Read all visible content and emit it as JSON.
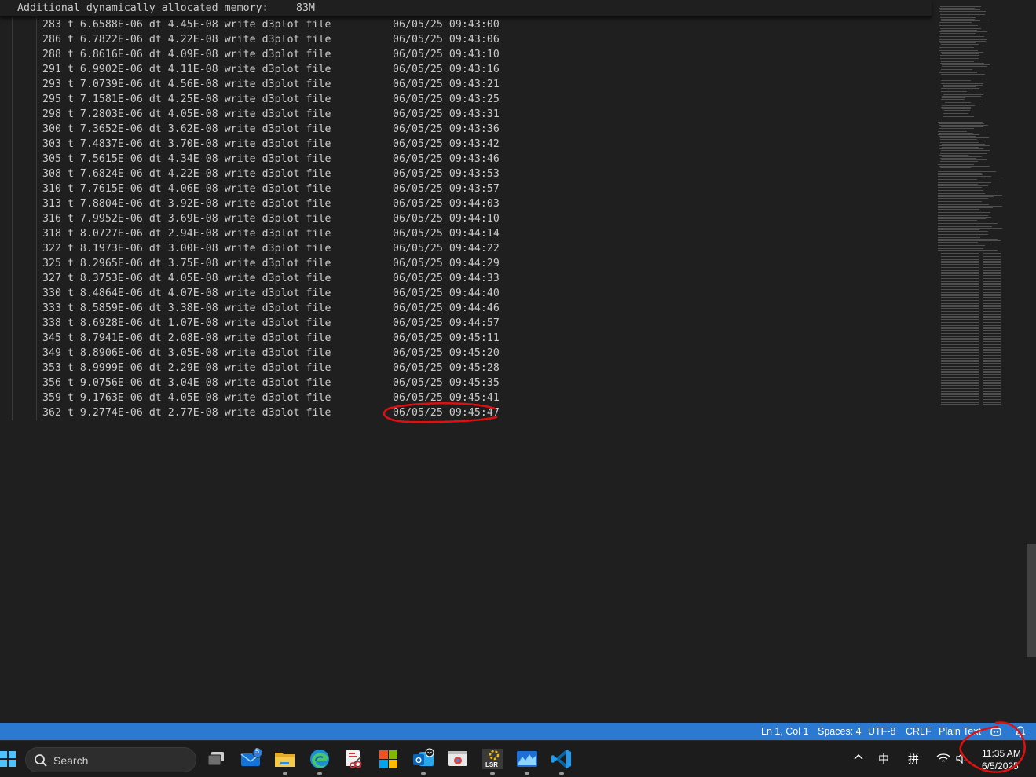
{
  "editor": {
    "sticky_line": {
      "label": "Additional dynamically allocated memory:",
      "value": "83M"
    },
    "lines": [
      {
        "text": "283 t 6.6588E-06 dt 4.45E-08 write d3plot file",
        "time": "06/05/25 09:43:00"
      },
      {
        "text": "286 t 6.7822E-06 dt 4.22E-08 write d3plot file",
        "time": "06/05/25 09:43:06"
      },
      {
        "text": "288 t 6.8616E-06 dt 4.09E-08 write d3plot file",
        "time": "06/05/25 09:43:10"
      },
      {
        "text": "291 t 6.9902E-06 dt 4.11E-08 write d3plot file",
        "time": "06/05/25 09:43:16"
      },
      {
        "text": "293 t 7.0739E-06 dt 4.56E-08 write d3plot file",
        "time": "06/05/25 09:43:21"
      },
      {
        "text": "295 t 7.1581E-06 dt 4.25E-08 write d3plot file",
        "time": "06/05/25 09:43:25"
      },
      {
        "text": "298 t 7.2803E-06 dt 4.05E-08 write d3plot file",
        "time": "06/05/25 09:43:31"
      },
      {
        "text": "300 t 7.3652E-06 dt 3.62E-08 write d3plot file",
        "time": "06/05/25 09:43:36"
      },
      {
        "text": "303 t 7.4837E-06 dt 3.70E-08 write d3plot file",
        "time": "06/05/25 09:43:42"
      },
      {
        "text": "305 t 7.5615E-06 dt 4.34E-08 write d3plot file",
        "time": "06/05/25 09:43:46"
      },
      {
        "text": "308 t 7.6824E-06 dt 4.22E-08 write d3plot file",
        "time": "06/05/25 09:43:53"
      },
      {
        "text": "310 t 7.7615E-06 dt 4.06E-08 write d3plot file",
        "time": "06/05/25 09:43:57"
      },
      {
        "text": "313 t 7.8804E-06 dt 3.92E-08 write d3plot file",
        "time": "06/05/25 09:44:03"
      },
      {
        "text": "316 t 7.9952E-06 dt 3.69E-08 write d3plot file",
        "time": "06/05/25 09:44:10"
      },
      {
        "text": "318 t 8.0727E-06 dt 2.94E-08 write d3plot file",
        "time": "06/05/25 09:44:14"
      },
      {
        "text": "322 t 8.1973E-06 dt 3.00E-08 write d3plot file",
        "time": "06/05/25 09:44:22"
      },
      {
        "text": "325 t 8.2965E-06 dt 3.75E-08 write d3plot file",
        "time": "06/05/25 09:44:29"
      },
      {
        "text": "327 t 8.3753E-06 dt 4.05E-08 write d3plot file",
        "time": "06/05/25 09:44:33"
      },
      {
        "text": "330 t 8.4864E-06 dt 4.07E-08 write d3plot file",
        "time": "06/05/25 09:44:40"
      },
      {
        "text": "333 t 8.5859E-06 dt 3.38E-08 write d3plot file",
        "time": "06/05/25 09:44:46"
      },
      {
        "text": "338 t 8.6928E-06 dt 1.07E-08 write d3plot file",
        "time": "06/05/25 09:44:57"
      },
      {
        "text": "345 t 8.7941E-06 dt 2.08E-08 write d3plot file",
        "time": "06/05/25 09:45:11"
      },
      {
        "text": "349 t 8.8906E-06 dt 3.05E-08 write d3plot file",
        "time": "06/05/25 09:45:20"
      },
      {
        "text": "353 t 8.9999E-06 dt 2.29E-08 write d3plot file",
        "time": "06/05/25 09:45:28"
      },
      {
        "text": "356 t 9.0756E-06 dt 3.04E-08 write d3plot file",
        "time": "06/05/25 09:45:35"
      },
      {
        "text": "359 t 9.1763E-06 dt 4.05E-08 write d3plot file",
        "time": "06/05/25 09:45:41"
      },
      {
        "text": "362 t 9.2774E-06 dt 2.77E-08 write d3plot file",
        "time": "06/05/25 09:45:47"
      }
    ]
  },
  "statusbar": {
    "position": "Ln 1, Col 1",
    "spaces": "Spaces: 4",
    "encoding": "UTF-8",
    "eol": "CRLF",
    "language": "Plain Text",
    "copilot_icon": "copilot-icon",
    "bell_icon": "bell-icon",
    "color": "#2b79d1"
  },
  "taskbar": {
    "search_placeholder": "Search",
    "mail_badge": "5",
    "apps": [
      "task-view",
      "mail",
      "file-explorer",
      "edge",
      "snipping-tool",
      "microsoft-store",
      "outlook",
      "chrome-remote",
      "lsr",
      "stock-app",
      "vscode"
    ],
    "lsr_label": "LSR",
    "tray": {
      "ime_lang": "中",
      "ime_mode": "拼",
      "time": "11:35 AM",
      "date": "6/5/2025"
    }
  },
  "colors": {
    "editor_bg": "#1f1f1f",
    "text": "#cccccc",
    "annotation": "#e01010"
  }
}
